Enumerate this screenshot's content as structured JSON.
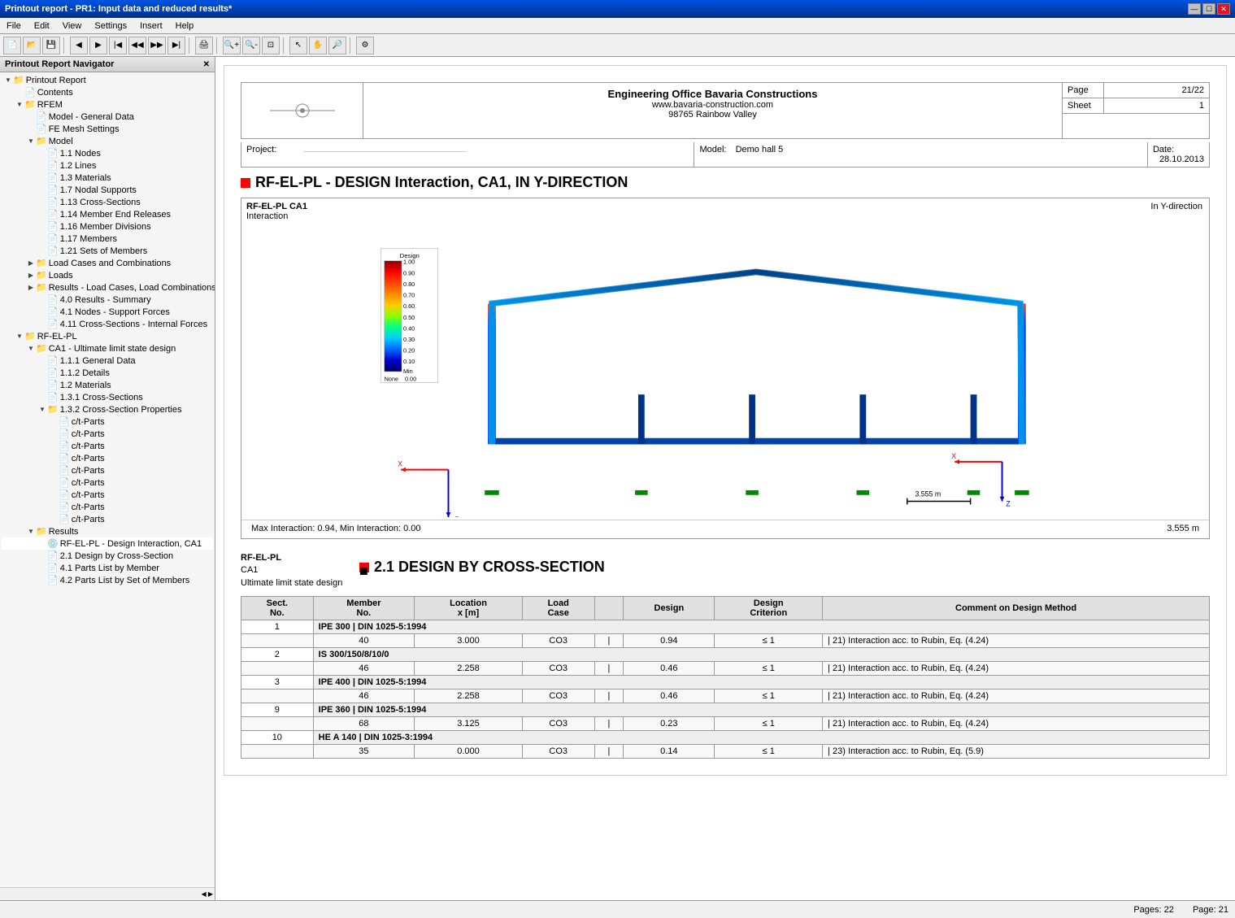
{
  "window": {
    "title": "Printout report - PR1: Input data and reduced results*",
    "controls": [
      "minimize",
      "maximize",
      "close"
    ]
  },
  "menubar": {
    "items": [
      "File",
      "Edit",
      "View",
      "Settings",
      "Insert",
      "Help"
    ]
  },
  "toolbar": {
    "buttons": [
      "new",
      "open",
      "save",
      "print",
      "back",
      "forward",
      "first",
      "prev",
      "next",
      "last",
      "print2",
      "zoom-in",
      "zoom-out",
      "fit",
      "select",
      "pan",
      "settings"
    ]
  },
  "left_panel": {
    "title": "Printout Report Navigator",
    "tree": [
      {
        "level": 0,
        "type": "folder",
        "label": "Printout Report",
        "expanded": true
      },
      {
        "level": 1,
        "type": "doc",
        "label": "Contents"
      },
      {
        "level": 1,
        "type": "folder",
        "label": "RFEM",
        "expanded": true
      },
      {
        "level": 2,
        "type": "doc",
        "label": "Model - General Data"
      },
      {
        "level": 2,
        "type": "doc",
        "label": "FE Mesh Settings"
      },
      {
        "level": 2,
        "type": "folder",
        "label": "Model",
        "expanded": true
      },
      {
        "level": 3,
        "type": "doc",
        "label": "1.1 Nodes"
      },
      {
        "level": 3,
        "type": "doc",
        "label": "1.2 Lines"
      },
      {
        "level": 3,
        "type": "doc",
        "label": "1.3 Materials"
      },
      {
        "level": 3,
        "type": "doc",
        "label": "1.7 Nodal Supports"
      },
      {
        "level": 3,
        "type": "doc",
        "label": "1.13 Cross-Sections"
      },
      {
        "level": 3,
        "type": "doc",
        "label": "1.14 Member End Releases"
      },
      {
        "level": 3,
        "type": "doc",
        "label": "1.16 Member Divisions"
      },
      {
        "level": 3,
        "type": "doc",
        "label": "1.17 Members"
      },
      {
        "level": 3,
        "type": "doc",
        "label": "1.21 Sets of Members"
      },
      {
        "level": 2,
        "type": "folder",
        "label": "Load Cases and Combinations",
        "expanded": false
      },
      {
        "level": 2,
        "type": "folder",
        "label": "Loads",
        "expanded": false
      },
      {
        "level": 2,
        "type": "folder",
        "label": "Results - Load Cases, Load Combinations",
        "expanded": false
      },
      {
        "level": 3,
        "type": "doc",
        "label": "4.0 Results - Summary"
      },
      {
        "level": 3,
        "type": "doc",
        "label": "4.1 Nodes - Support Forces"
      },
      {
        "level": 3,
        "type": "doc",
        "label": "4.11 Cross-Sections - Internal Forces"
      },
      {
        "level": 1,
        "type": "folder",
        "label": "RF-EL-PL",
        "expanded": true
      },
      {
        "level": 2,
        "type": "folder",
        "label": "CA1 - Ultimate limit state design",
        "expanded": true
      },
      {
        "level": 3,
        "type": "doc",
        "label": "1.1.1 General Data"
      },
      {
        "level": 3,
        "type": "doc",
        "label": "1.1.2 Details"
      },
      {
        "level": 3,
        "type": "doc",
        "label": "1.2 Materials"
      },
      {
        "level": 3,
        "type": "doc",
        "label": "1.3.1 Cross-Sections"
      },
      {
        "level": 3,
        "type": "folder",
        "label": "1.3.2 Cross-Section Properties",
        "expanded": true
      },
      {
        "level": 4,
        "type": "doc",
        "label": "c/t-Parts"
      },
      {
        "level": 4,
        "type": "doc",
        "label": "c/t-Parts"
      },
      {
        "level": 4,
        "type": "doc",
        "label": "c/t-Parts"
      },
      {
        "level": 4,
        "type": "doc",
        "label": "c/t-Parts"
      },
      {
        "level": 4,
        "type": "doc",
        "label": "c/t-Parts"
      },
      {
        "level": 4,
        "type": "doc",
        "label": "c/t-Parts"
      },
      {
        "level": 4,
        "type": "doc",
        "label": "c/t-Parts"
      },
      {
        "level": 4,
        "type": "doc",
        "label": "c/t-Parts"
      },
      {
        "level": 4,
        "type": "doc",
        "label": "c/t-Parts"
      },
      {
        "level": 2,
        "type": "folder",
        "label": "Results",
        "expanded": true
      },
      {
        "level": 3,
        "type": "doc-active",
        "label": "RF-EL-PL - Design Interaction, CA1"
      },
      {
        "level": 3,
        "type": "doc",
        "label": "2.1 Design by Cross-Section"
      },
      {
        "level": 3,
        "type": "doc",
        "label": "4.1 Parts List by Member"
      },
      {
        "level": 3,
        "type": "doc",
        "label": "4.2 Parts List by Set of Members"
      }
    ]
  },
  "report": {
    "page_label": "Page",
    "page_value": "21/22",
    "sheet_label": "Sheet",
    "sheet_value": "1",
    "company": "Engineering Office Bavaria Constructions",
    "website": "www.bavaria-construction.com",
    "address": "98765 Rainbow Valley",
    "project_label": "Project:",
    "project_value": "",
    "model_label": "Model:",
    "model_value": "Demo hall 5",
    "date_label": "Date:",
    "date_value": "28.10.2013",
    "section1_title": "RF-EL-PL - DESIGN Interaction, CA1, IN Y-DIRECTION",
    "diagram_title": "RF-EL-PL CA1",
    "diagram_subtitle": "Interaction",
    "in_direction": "In Y-direction",
    "legend": {
      "title": "Design",
      "values": [
        "1.00",
        "0.90",
        "0.80",
        "0.70",
        "0.60",
        "0.50",
        "0.40",
        "0.30",
        "0.20",
        "0.10",
        "Min"
      ]
    },
    "diagram_footer": "Max Interaction: 0.94, Min Interaction: 0.00",
    "scale": "3.555 m",
    "section2_title": "2.1 DESIGN BY CROSS-SECTION",
    "rf_el_pl_label": "RF-EL-PL",
    "ca1_label": "CA1",
    "uls_label": "Ultimate limit state design",
    "table": {
      "headers": [
        "Sect.\nNo.",
        "Member\nNo.",
        "Location\nx [m]",
        "Load\nCase",
        "",
        "Design",
        "Design\nCriterion",
        "Comment on Design Method"
      ],
      "rows": [
        {
          "sect": "1",
          "section_name": "IPE 300 | DIN 1025-5:1994",
          "member": "40",
          "location": "3.000",
          "load_case": "CO3",
          "design": "0.94",
          "criterion": "≤ 1",
          "comment": "| 21) Interaction acc. to Rubin, Eq. (4.24)"
        },
        {
          "sect": "2",
          "section_name": "IS 300/150/8/10/0",
          "member": "46",
          "location": "2.258",
          "load_case": "CO3",
          "design": "0.46",
          "criterion": "≤ 1",
          "comment": "| 21) Interaction acc. to Rubin, Eq. (4.24)"
        },
        {
          "sect": "3",
          "section_name": "IPE 400 | DIN 1025-5:1994",
          "member": "46",
          "location": "2.258",
          "load_case": "CO3",
          "design": "0.46",
          "criterion": "≤ 1",
          "comment": "| 21) Interaction acc. to Rubin, Eq. (4.24)"
        },
        {
          "sect": "9",
          "section_name": "IPE 360 | DIN 1025-5:1994",
          "member": "68",
          "location": "3.125",
          "load_case": "CO3",
          "design": "0.23",
          "criterion": "≤ 1",
          "comment": "| 21) Interaction acc. to Rubin, Eq. (4.24)"
        },
        {
          "sect": "10",
          "section_name": "HE A 140 | DIN 1025-3:1994",
          "member": "35",
          "location": "0.000",
          "load_case": "CO3",
          "design": "0.14",
          "criterion": "≤ 1",
          "comment": "| 23) Interaction acc. to Rubin, Eq. (5.9)"
        }
      ]
    }
  },
  "statusbar": {
    "pages_label": "Pages:",
    "pages_value": "22",
    "page_label": "Page:",
    "page_value": "21"
  }
}
